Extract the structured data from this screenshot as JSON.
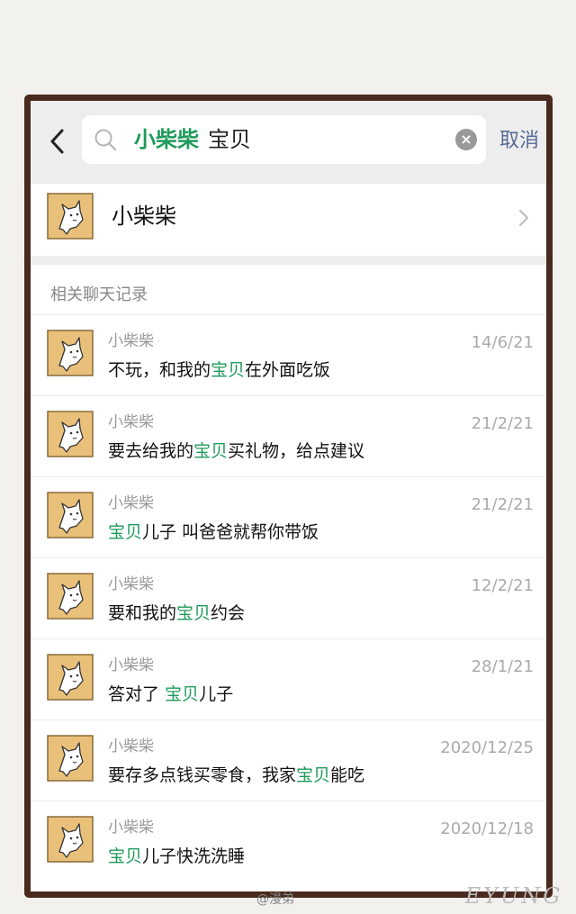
{
  "search": {
    "back_icon": "chevron-left-icon",
    "search_icon": "magnifier-icon",
    "query_highlight": "小柴柴",
    "query_rest": "宝贝",
    "clear_icon": "clear-circle-icon",
    "cancel_label": "取消"
  },
  "contact": {
    "name": "小柴柴",
    "chevron_icon": "chevron-right-icon"
  },
  "records": {
    "section_title": "相关聊天记录",
    "items": [
      {
        "sender": "小柴柴",
        "date": "14/6/21",
        "msg": [
          {
            "t": "不玩，和我的"
          },
          {
            "t": "宝贝",
            "hl": true
          },
          {
            "t": "在外面吃饭"
          }
        ]
      },
      {
        "sender": "小柴柴",
        "date": "21/2/21",
        "msg": [
          {
            "t": "要去给我的"
          },
          {
            "t": "宝贝",
            "hl": true
          },
          {
            "t": "买礼物，给点建议"
          }
        ]
      },
      {
        "sender": "小柴柴",
        "date": "21/2/21",
        "msg": [
          {
            "t": "宝贝",
            "hl": true
          },
          {
            "t": "儿子 叫爸爸就帮你带饭"
          }
        ]
      },
      {
        "sender": "小柴柴",
        "date": "12/2/21",
        "msg": [
          {
            "t": "要和我的"
          },
          {
            "t": "宝贝",
            "hl": true
          },
          {
            "t": "约会"
          }
        ]
      },
      {
        "sender": "小柴柴",
        "date": "28/1/21",
        "msg": [
          {
            "t": "答对了 "
          },
          {
            "t": "宝贝",
            "hl": true
          },
          {
            "t": "儿子"
          }
        ]
      },
      {
        "sender": "小柴柴",
        "date": "2020/12/25",
        "msg": [
          {
            "t": "要存多点钱买零食，我家"
          },
          {
            "t": "宝贝",
            "hl": true
          },
          {
            "t": "能吃"
          }
        ]
      },
      {
        "sender": "小柴柴",
        "date": "2020/12/18",
        "msg": [
          {
            "t": "宝贝",
            "hl": true
          },
          {
            "t": "儿子快洗洗睡"
          }
        ]
      }
    ]
  },
  "watermarks": {
    "weibo": "@漫弟",
    "logo": "EYUNG"
  },
  "colors": {
    "highlight": "#1f9b5a",
    "link": "#576b95",
    "frame": "#4a2a1e",
    "avatar_bg": "#e9c07a"
  }
}
